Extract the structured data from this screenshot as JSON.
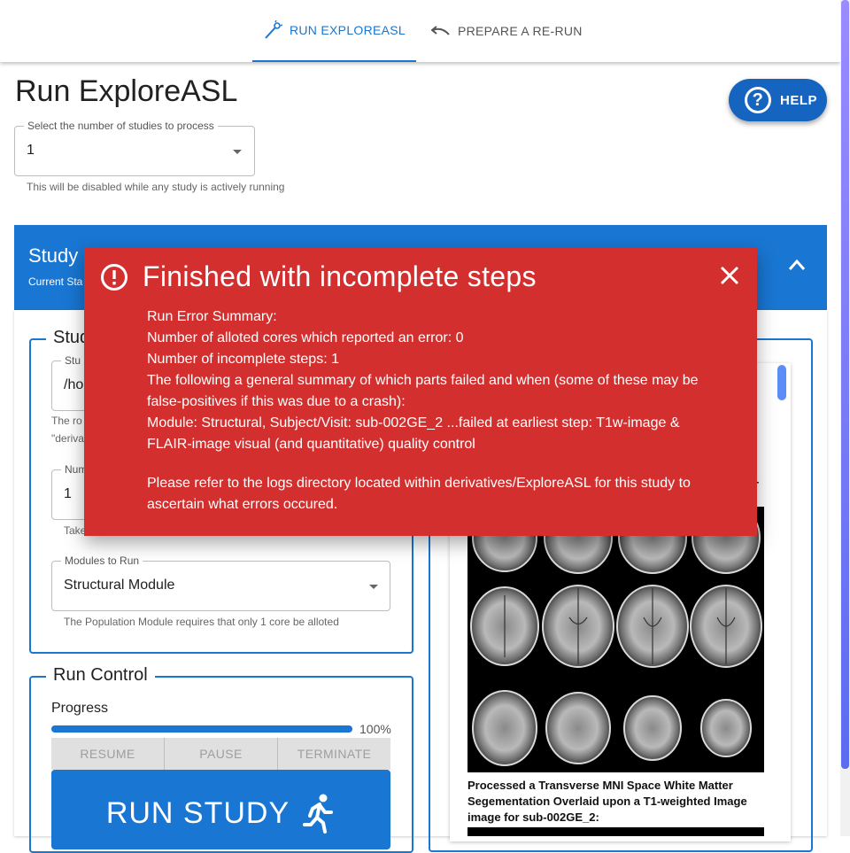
{
  "tabs": [
    {
      "label": "RUN EXPLOREASL",
      "icon": "wand-icon",
      "active": true
    },
    {
      "label": "PREPARE A RE-RUN",
      "icon": "undo-icon",
      "active": false
    }
  ],
  "page_title": "Run ExploreASL",
  "help_button": {
    "label": "HELP",
    "icon": "help-circle-icon"
  },
  "studies_select": {
    "label": "Select the number of studies to process",
    "value": "1",
    "helper": "This will be disabled while any study is actively running"
  },
  "study_panel": {
    "title_fragment": "Study",
    "status_fragment": "Current Sta",
    "section_fragment": "Stud",
    "study_field_label_fragment": "Stu",
    "study_field_value_fragment": "/ho",
    "study_helper_fragment_1": "The ro",
    "study_helper_fragment_2": "\"deriva",
    "cores_label_fragment": "Num",
    "cores_value": "1",
    "cores_helper_fragment": "Take",
    "modules_label": "Modules to Run",
    "modules_value": "Structural Module",
    "modules_helper": "The Population Module requires that only 1 core be alloted"
  },
  "run_control": {
    "title": "Run Control",
    "progress_label": "Progress",
    "progress_percent_text": "100%",
    "progress_value": 100,
    "buttons": [
      "RESUME",
      "PAUSE",
      "TERMINATE"
    ],
    "run_label": "RUN STUDY"
  },
  "image_panel": {
    "fragment_text": "-",
    "caption": "Processed a Transverse MNI Space White Matter Segementation Overlaid upon a T1-weighted Image image for sub-002GE_2:"
  },
  "modal": {
    "title": "Finished with incomplete steps",
    "lines": [
      "Run Error Summary:",
      "Number of alloted cores which reported an error: 0",
      "Number of incomplete steps: 1",
      "The following a general summary of which parts failed and when (some of these may be false-positives if this was due to a crash):",
      "Module: Structural, Subject/Visit: sub-002GE_2 ...failed at earliest step: T1w-image & FLAIR-image visual (and quantitative) quality control"
    ],
    "footer": "Please refer to the logs directory located within derivatives/ExploreASL for this study to ascertain what errors occured."
  },
  "colors": {
    "primary": "#1976d2",
    "error": "#d32f2f",
    "help": "#1565c0"
  }
}
